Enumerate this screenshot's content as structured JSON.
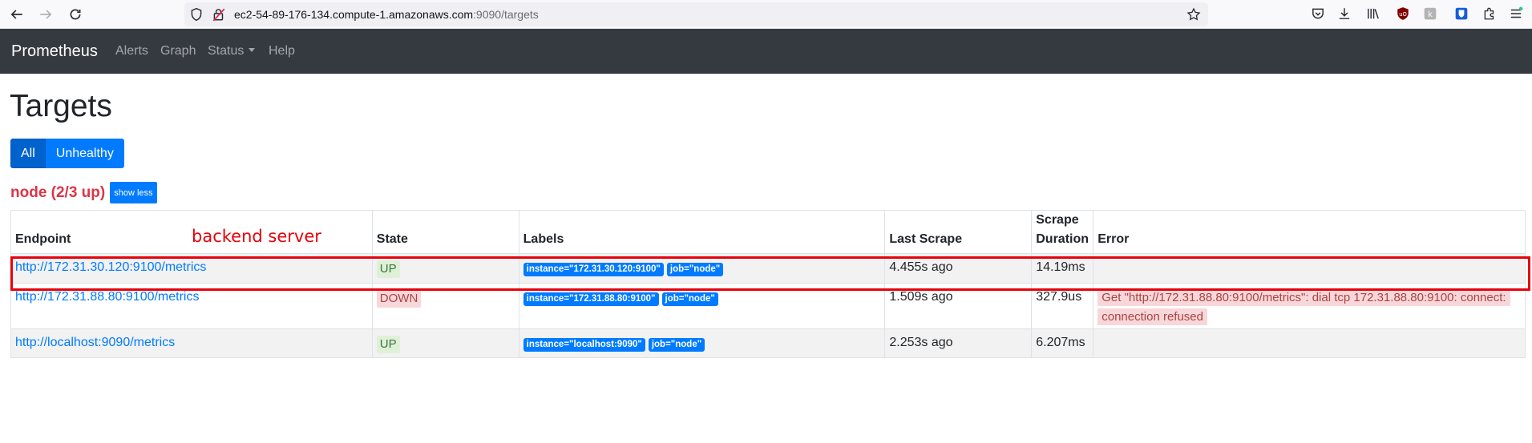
{
  "browser": {
    "url_host": "ec2-54-89-176-134.compute-1.amazonaws.com",
    "url_rest": ":9090/targets",
    "icons": [
      "back-icon",
      "forward-icon",
      "reload-icon",
      "shield-icon",
      "lock-warning-icon",
      "star-icon",
      "pocket-icon",
      "download-icon",
      "library-icon",
      "ublock-icon",
      "extension-icon",
      "bitwarden-icon",
      "puzzle-icon",
      "menu-icon"
    ]
  },
  "navbar": {
    "brand": "Prometheus",
    "links": [
      "Alerts",
      "Graph",
      "Status",
      "Help"
    ]
  },
  "page": {
    "title": "Targets",
    "filter_all": "All",
    "filter_unhealthy": "Unhealthy",
    "pool_title": "node (2/3 up)",
    "show_less": "show less"
  },
  "table": {
    "headers": {
      "endpoint": "Endpoint",
      "state": "State",
      "labels": "Labels",
      "last_scrape": "Last Scrape",
      "scrape_duration_1": "Scrape",
      "scrape_duration_2": "Duration",
      "error": "Error"
    },
    "rows": [
      {
        "endpoint": "http://172.31.30.120:9100/metrics",
        "state": "UP",
        "label_instance": "instance=\"172.31.30.120:9100\"",
        "label_job": "job=\"node\"",
        "last_scrape": "4.455s ago",
        "scrape_duration": "14.19ms",
        "error": ""
      },
      {
        "endpoint": "http://172.31.88.80:9100/metrics",
        "state": "DOWN",
        "label_instance": "instance=\"172.31.88.80:9100\"",
        "label_job": "job=\"node\"",
        "last_scrape": "1.509s ago",
        "scrape_duration": "327.9us",
        "error": "Get \"http://172.31.88.80:9100/metrics\": dial tcp 172.31.88.80:9100: connect: connection refused"
      },
      {
        "endpoint": "http://localhost:9090/metrics",
        "state": "UP",
        "label_instance": "instance=\"localhost:9090\"",
        "label_job": "job=\"node\"",
        "last_scrape": "2.253s ago",
        "scrape_duration": "6.207ms",
        "error": ""
      }
    ]
  },
  "annotation": {
    "text": "backend server",
    "color": "#e8000b"
  },
  "colors": {
    "primary": "#007bff",
    "navbar_bg": "#343a40",
    "danger": "#dc3545"
  }
}
